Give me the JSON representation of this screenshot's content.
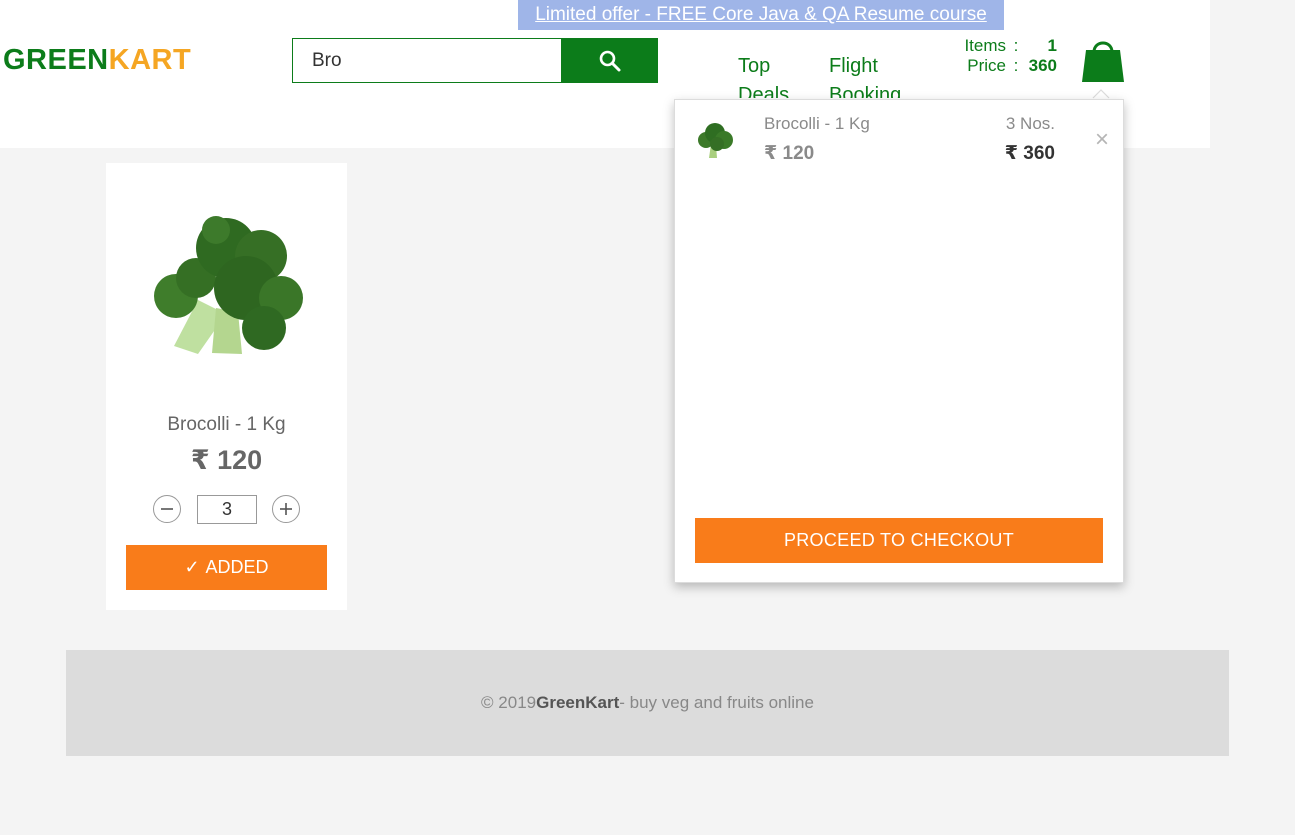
{
  "promo": {
    "text": "Limited offer - FREE Core Java & QA Resume course"
  },
  "brand": {
    "part1": "GREEN",
    "part2": "KART",
    "color1": "#0c7c1a",
    "color2": "#f5a623"
  },
  "search": {
    "value": "Bro",
    "button_icon": "search-icon"
  },
  "nav": [
    {
      "label": "Top Deals"
    },
    {
      "label": "Flight Booking"
    }
  ],
  "cart_info": {
    "items_label": "Items",
    "items_value": "1",
    "price_label": "Price",
    "price_value": "360",
    "separator": ":"
  },
  "cart_preview": {
    "items": [
      {
        "name": "Brocolli - 1 Kg",
        "price": "₹ 120",
        "quantity": "3 Nos.",
        "amount": "₹ 360",
        "remove_symbol": "×"
      }
    ],
    "checkout_label": "PROCEED TO CHECKOUT"
  },
  "products": [
    {
      "name": "Brocolli - 1 Kg",
      "price": "₹ 120",
      "quantity": "3",
      "button_label": "ADDED",
      "button_check": "✓"
    }
  ],
  "footer": {
    "prefix": "© 2019 ",
    "brand": "GreenKart",
    "suffix": " - buy veg and fruits online"
  },
  "colors": {
    "accent_green": "#0c7c1a",
    "accent_orange": "#f97c1a",
    "promo_bg": "#9fb5e8",
    "page_bg": "#f4f4f4"
  }
}
